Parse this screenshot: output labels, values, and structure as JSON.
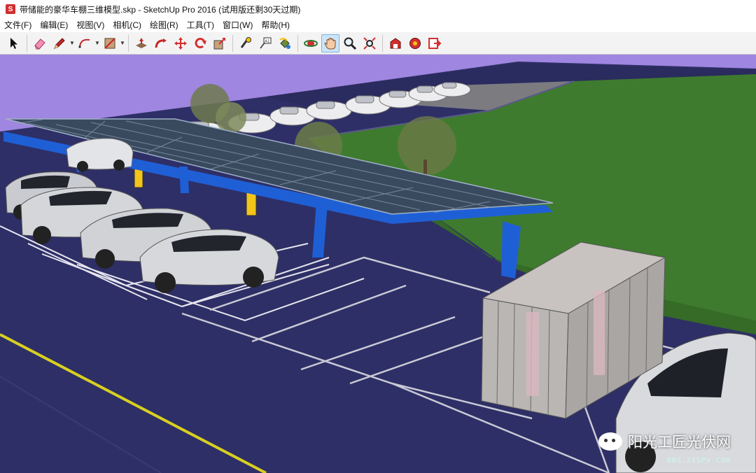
{
  "window": {
    "title": "带储能的豪华车棚三维模型.skp - SketchUp Pro 2016   (试用版还剩30天过期)"
  },
  "menu": [
    {
      "label": "文件(F)"
    },
    {
      "label": "编辑(E)"
    },
    {
      "label": "视图(V)"
    },
    {
      "label": "相机(C)"
    },
    {
      "label": "绘图(R)"
    },
    {
      "label": "工具(T)"
    },
    {
      "label": "窗口(W)"
    },
    {
      "label": "帮助(H)"
    }
  ],
  "toolbar": {
    "tools": [
      "select-icon",
      "eraser-icon",
      "pencil-icon",
      "arc-icon",
      "rectangle-icon",
      "push-pull-icon",
      "follow-me-icon",
      "move-icon",
      "rotate-icon",
      "offset-icon",
      "tape-measure-icon",
      "text-icon",
      "paint-bucket-icon",
      "orbit-icon",
      "pan-icon",
      "zoom-icon",
      "zoom-extents-icon",
      "warehouse-icon",
      "extension-icon",
      "share-icon"
    ],
    "active_tool": "pan-icon"
  },
  "watermark": {
    "label": "阳光工匠光伏网",
    "url": "BBS.21SPV.COM"
  },
  "colors": {
    "sky": "#9f86e0",
    "ground": "#2e2f66",
    "grass": "#3d7a2e",
    "canopy_frame": "#1f5fd6",
    "parking_lines": "#e6e6ef",
    "road_line": "#d8d020"
  }
}
